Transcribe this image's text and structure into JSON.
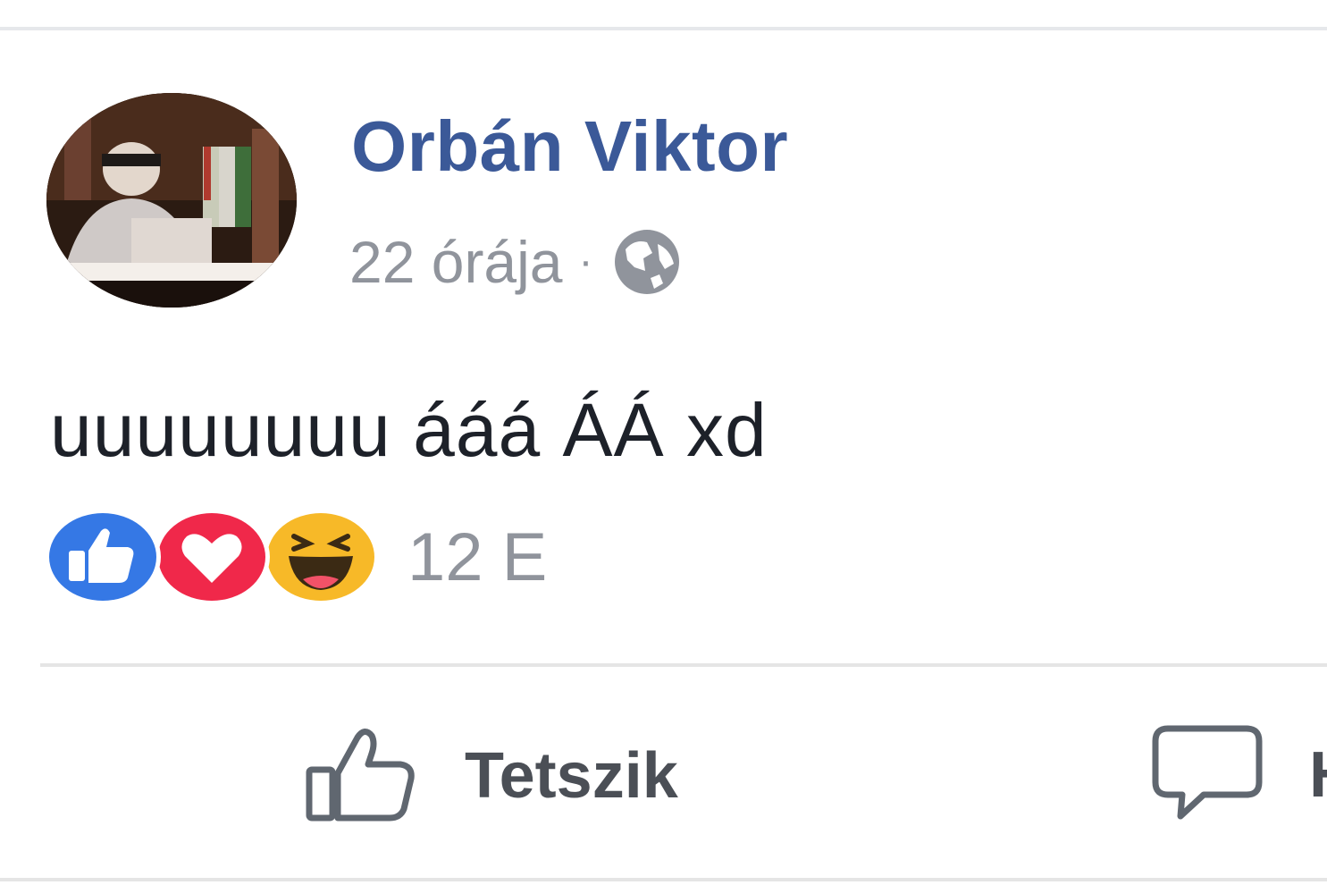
{
  "post": {
    "author": "Orbán Viktor",
    "time": "22 órája",
    "separator": "·",
    "privacy_icon": "globe-icon",
    "text": "uuuuuuuu ááá ÁÁ xd",
    "reactions": {
      "types": [
        "like",
        "love",
        "haha"
      ],
      "count": "12 E"
    },
    "actions": {
      "like_label": "Tetszik",
      "comment_label": "H"
    }
  },
  "colors": {
    "author": "#3b5998",
    "meta": "#90949c",
    "like_reaction": "#3578e5",
    "love_reaction": "#f0284a",
    "haha_reaction": "#f7b928"
  }
}
